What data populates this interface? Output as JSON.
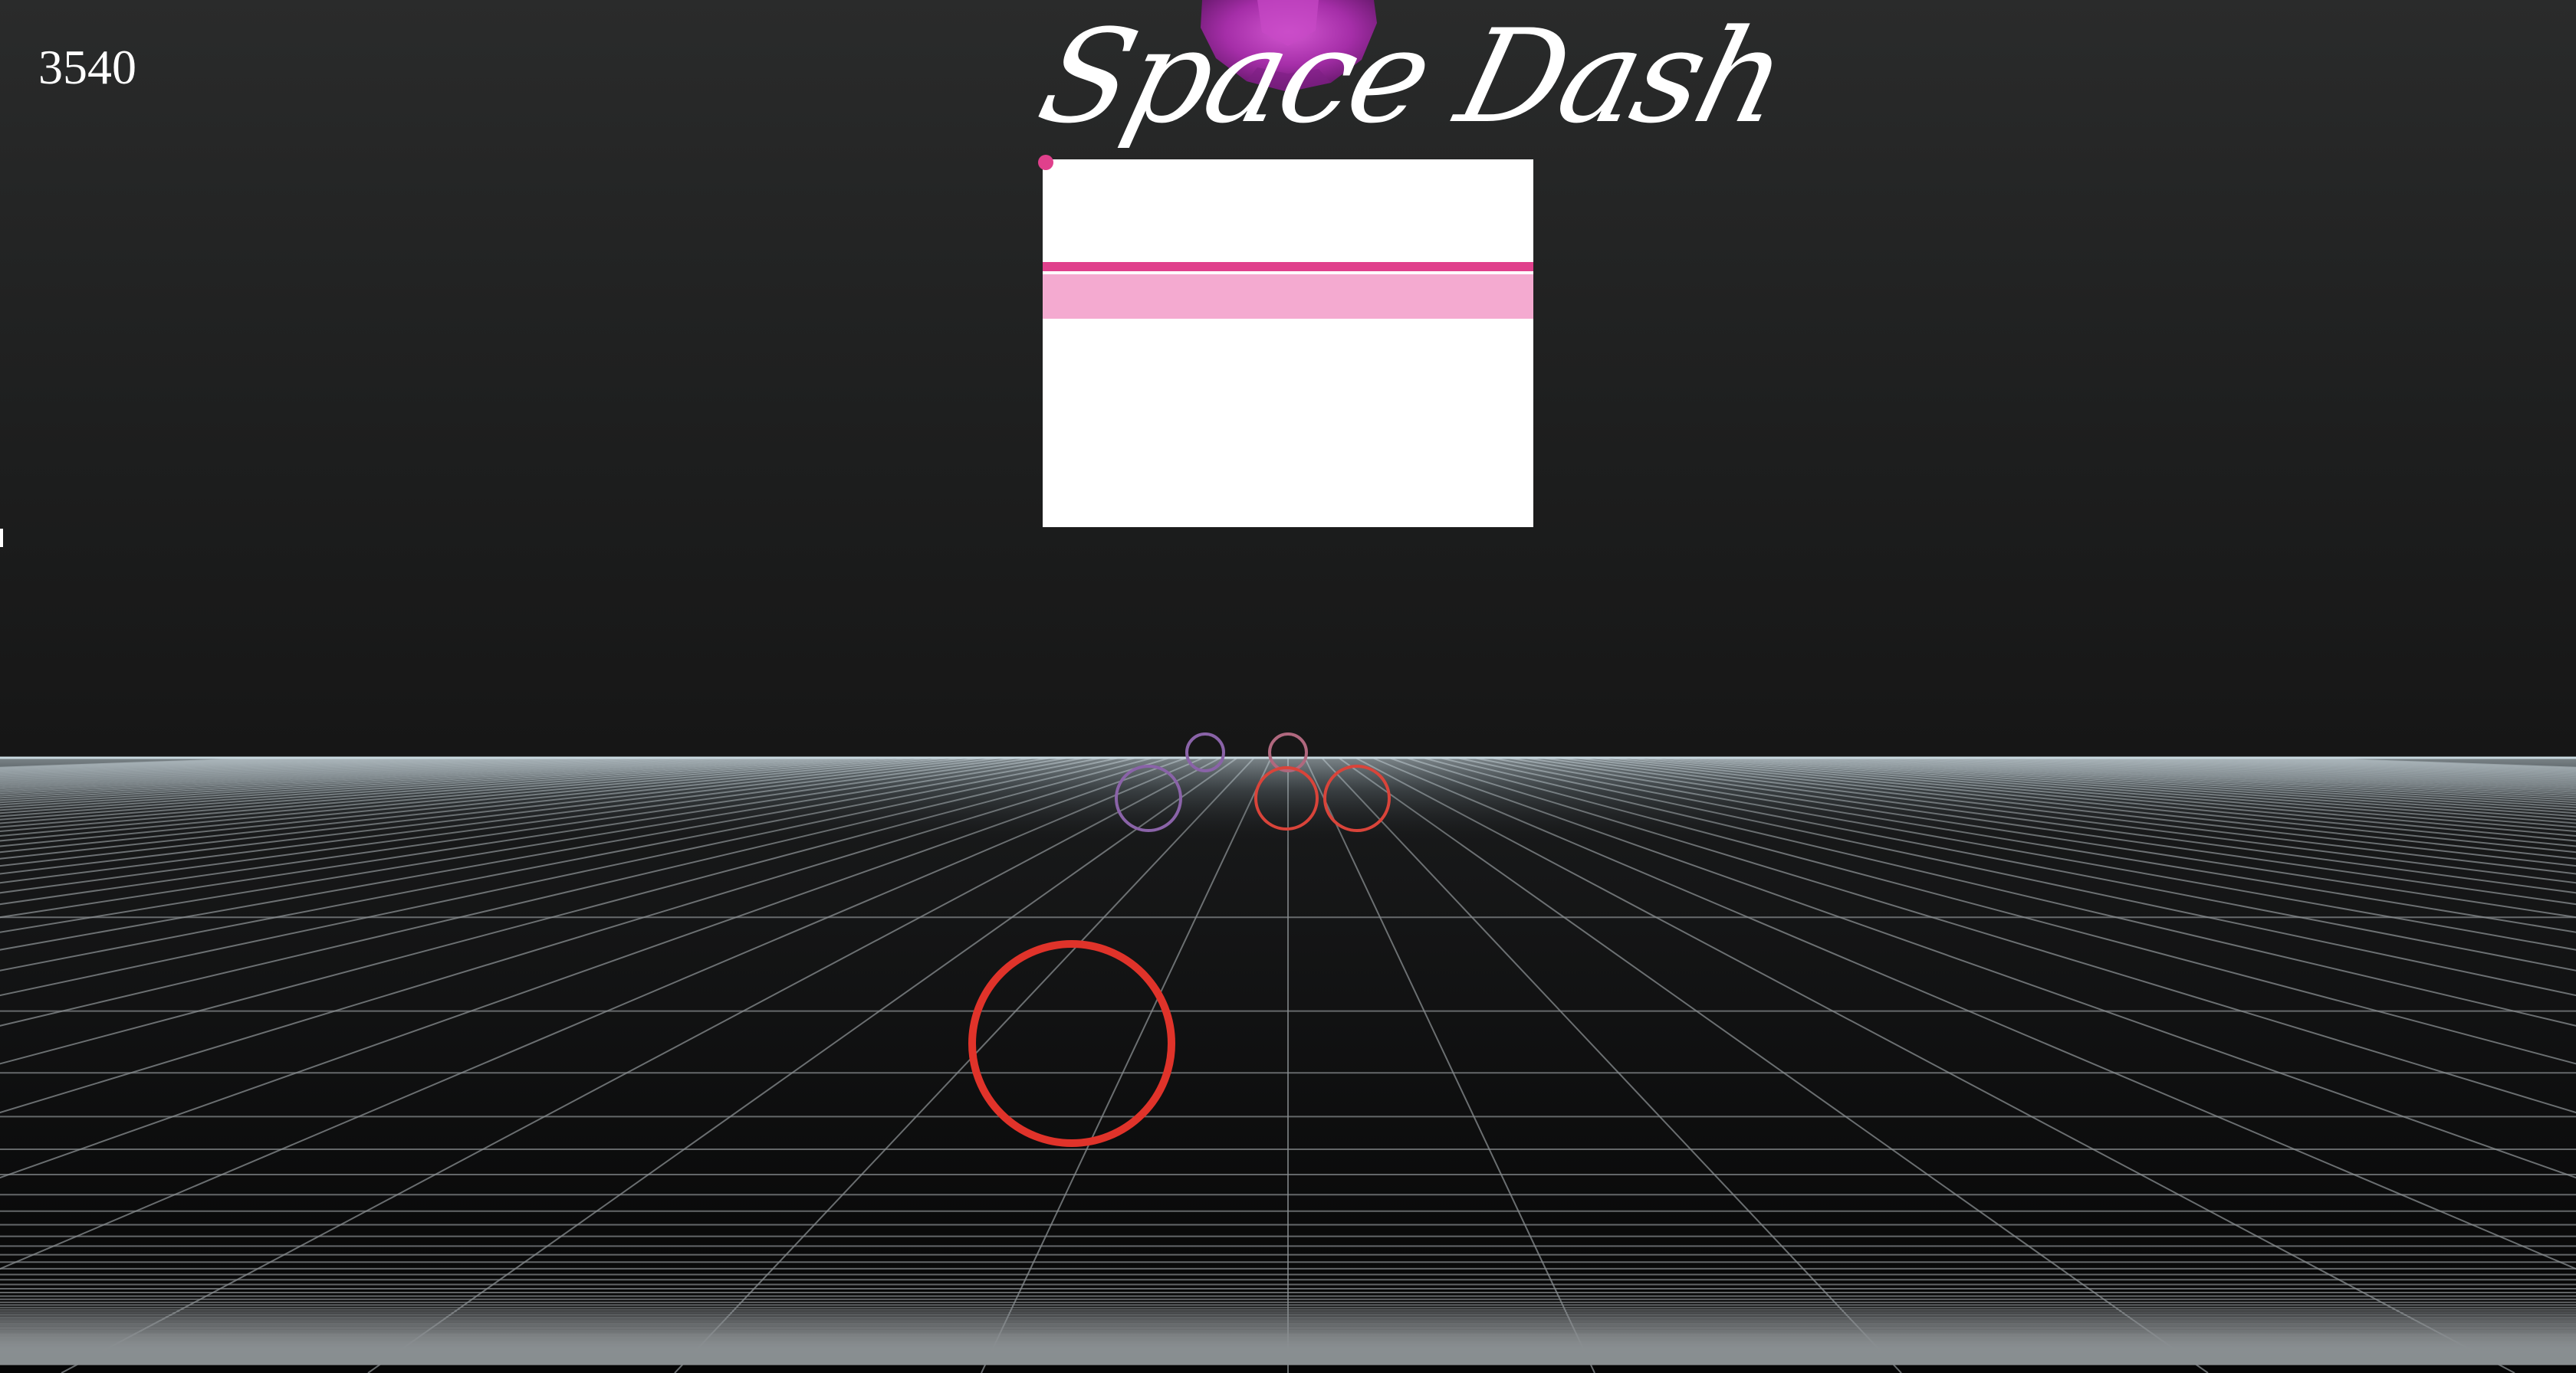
{
  "game": {
    "title": "Space Dash",
    "score": "3540"
  },
  "colors": {
    "background_top": "#2a2b2b",
    "background_bottom": "#0c0c0c",
    "grid_line": "#8a8f92",
    "horizon_glow": "#b9cdd6",
    "player_ship": "#e0332a",
    "obstacle_red": "#d9443a",
    "obstacle_purple": "#8a63a8",
    "obstacle_mauve": "#b0687e",
    "orb": "#a52ea8",
    "orb_highlight": "#c848c6",
    "panel_bg": "#ffffff",
    "panel_bar_dark": "#e0408c",
    "panel_bar_light": "#f4aad0"
  },
  "icons": {
    "player": "ring-icon",
    "orb": "faceted-sphere-icon"
  },
  "panel": {
    "label": ""
  }
}
